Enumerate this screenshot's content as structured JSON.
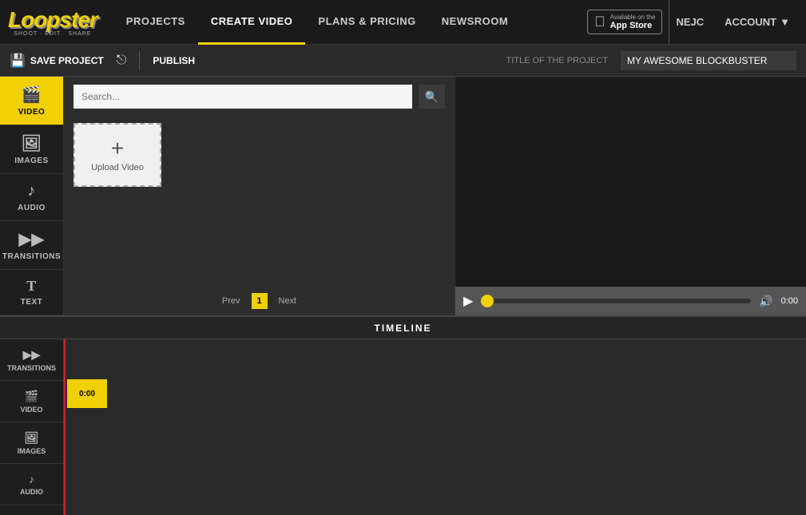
{
  "nav": {
    "logo": "Loopster",
    "tagline": "SHOOT · EDIT · SHARE",
    "items": [
      {
        "label": "PROJECTS",
        "active": false
      },
      {
        "label": "CREATE VIDEO",
        "active": true
      },
      {
        "label": "PLANS & PRICING",
        "active": false
      },
      {
        "label": "NEWSROOM",
        "active": false
      }
    ],
    "app_store_small": "Available on the",
    "app_store_big": "App Store",
    "user": "NEJC",
    "account": "ACCOUNT"
  },
  "toolbar": {
    "save_label": "SAVE PROJECT",
    "publish_label": "PUBLISH",
    "title_label": "TITLE OF THE PROJECT",
    "title_value": "MY AWESOME BLOCKBUSTER"
  },
  "sidebar": {
    "items": [
      {
        "label": "VIDEO",
        "active": true,
        "icon": "🎬"
      },
      {
        "label": "IMAGES",
        "active": false,
        "icon": "🖼"
      },
      {
        "label": "AUDIO",
        "active": false,
        "icon": "🎵"
      },
      {
        "label": "TRANSITIONS",
        "active": false,
        "icon": "▶▶"
      },
      {
        "label": "TEXT",
        "active": false,
        "icon": "T"
      }
    ]
  },
  "search": {
    "placeholder": "Search...",
    "value": ""
  },
  "upload": {
    "label": "Upload Video",
    "plus": "+"
  },
  "pagination": {
    "prev": "Prev",
    "current": "1",
    "next": "Next"
  },
  "player": {
    "time": "0:00"
  },
  "timeline": {
    "header": "TIMELINE",
    "tracks": [
      {
        "label": "TRANSITIONS",
        "icon": "▶▶"
      },
      {
        "label": "VIDEO",
        "icon": "🎬"
      },
      {
        "label": "IMAGES",
        "icon": "🖼"
      },
      {
        "label": "AUDIO",
        "icon": "🎵"
      }
    ],
    "clip_time": "0:00"
  }
}
